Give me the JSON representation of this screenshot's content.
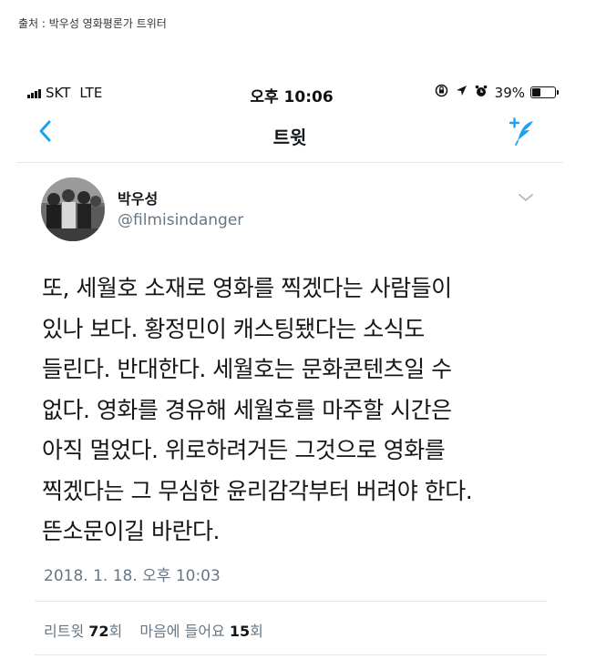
{
  "source_caption": "출처 : 박우성 영화평론가 트위터",
  "status_bar": {
    "carrier": "SKT",
    "network": "LTE",
    "time": "오후 10:06",
    "battery_percent": "39%",
    "battery_level": 0.39
  },
  "nav": {
    "title": "트윗",
    "accent_color": "#1da1f2"
  },
  "tweet": {
    "author_name": "박우성",
    "author_handle": "@filmisindanger",
    "text_lines": [
      "또, 세월호 소재로 영화를 찍겠다는 사람들이",
      "있나 보다. 황정민이 캐스팅됐다는 소식도",
      "들린다. 반대한다. 세월호는 문화콘텐츠일 수",
      "없다. 영화를 경유해 세월호를 마주할 시간은",
      "아직 멀었다. 위로하려거든 그것으로 영화를",
      "찍겠다는 그 무심한 윤리감각부터 버려야 한다.",
      "뜬소문이길 바란다."
    ],
    "timestamp": "2018. 1. 18. 오후 10:03",
    "stats": {
      "retweet_label": "리트윗",
      "retweet_count": "72",
      "retweet_unit": "회",
      "like_label": "마음에 들어요",
      "like_count": "15",
      "like_unit": "회"
    }
  }
}
